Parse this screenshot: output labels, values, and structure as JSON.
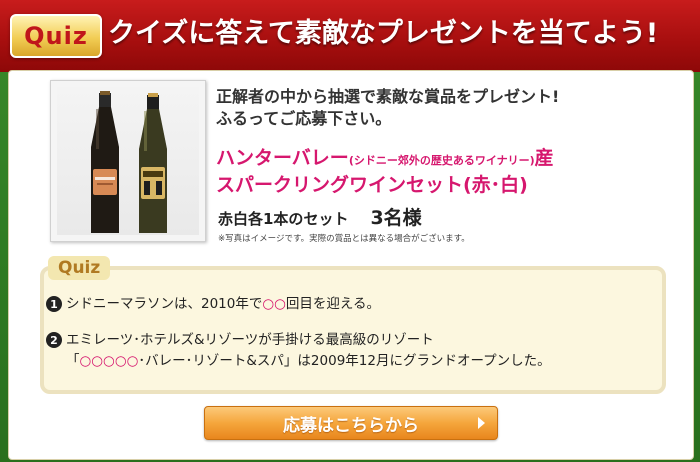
{
  "header": {
    "badge": "Quiz",
    "title": "クイズに答えて素敵なプレゼントを当てよう!"
  },
  "prize": {
    "intro_line1": "正解者の中から抽選で素敵な賞品をプレゼント!",
    "intro_line2": "ふるってご応募下さい。",
    "name_part1": "ハンターバレー",
    "name_small": "(シドニー郊外の歴史あるワイナリー)",
    "name_part2": "産",
    "name_line2": "スパークリングワインセット(赤･白)",
    "quantity_label": "赤白各1本のセット",
    "quantity_count": "3名様",
    "note": "※写真はイメージです。実際の賞品とは異なる場合がございます。"
  },
  "quiz": {
    "tab_label": "Quiz",
    "q1_num": "1",
    "q1_before": "シドニーマラソンは、2010年で",
    "q1_blank": "○○",
    "q1_after": "回目を迎える。",
    "q2_num": "2",
    "q2_line1": "エミレーツ･ホテルズ&リゾーツが手掛ける最高級のリゾート",
    "q2_open": "「",
    "q2_blank": "○○○○○",
    "q2_after": "･バレー･リゾート&スパ」は2009年12月にグランドオープンした。"
  },
  "cta": {
    "label": "応募はこちらから"
  },
  "colors": {
    "header_red": "#b01212",
    "green_frame": "#2f7a21",
    "accent_pink": "#d6176e",
    "button_orange": "#f5a63c"
  }
}
